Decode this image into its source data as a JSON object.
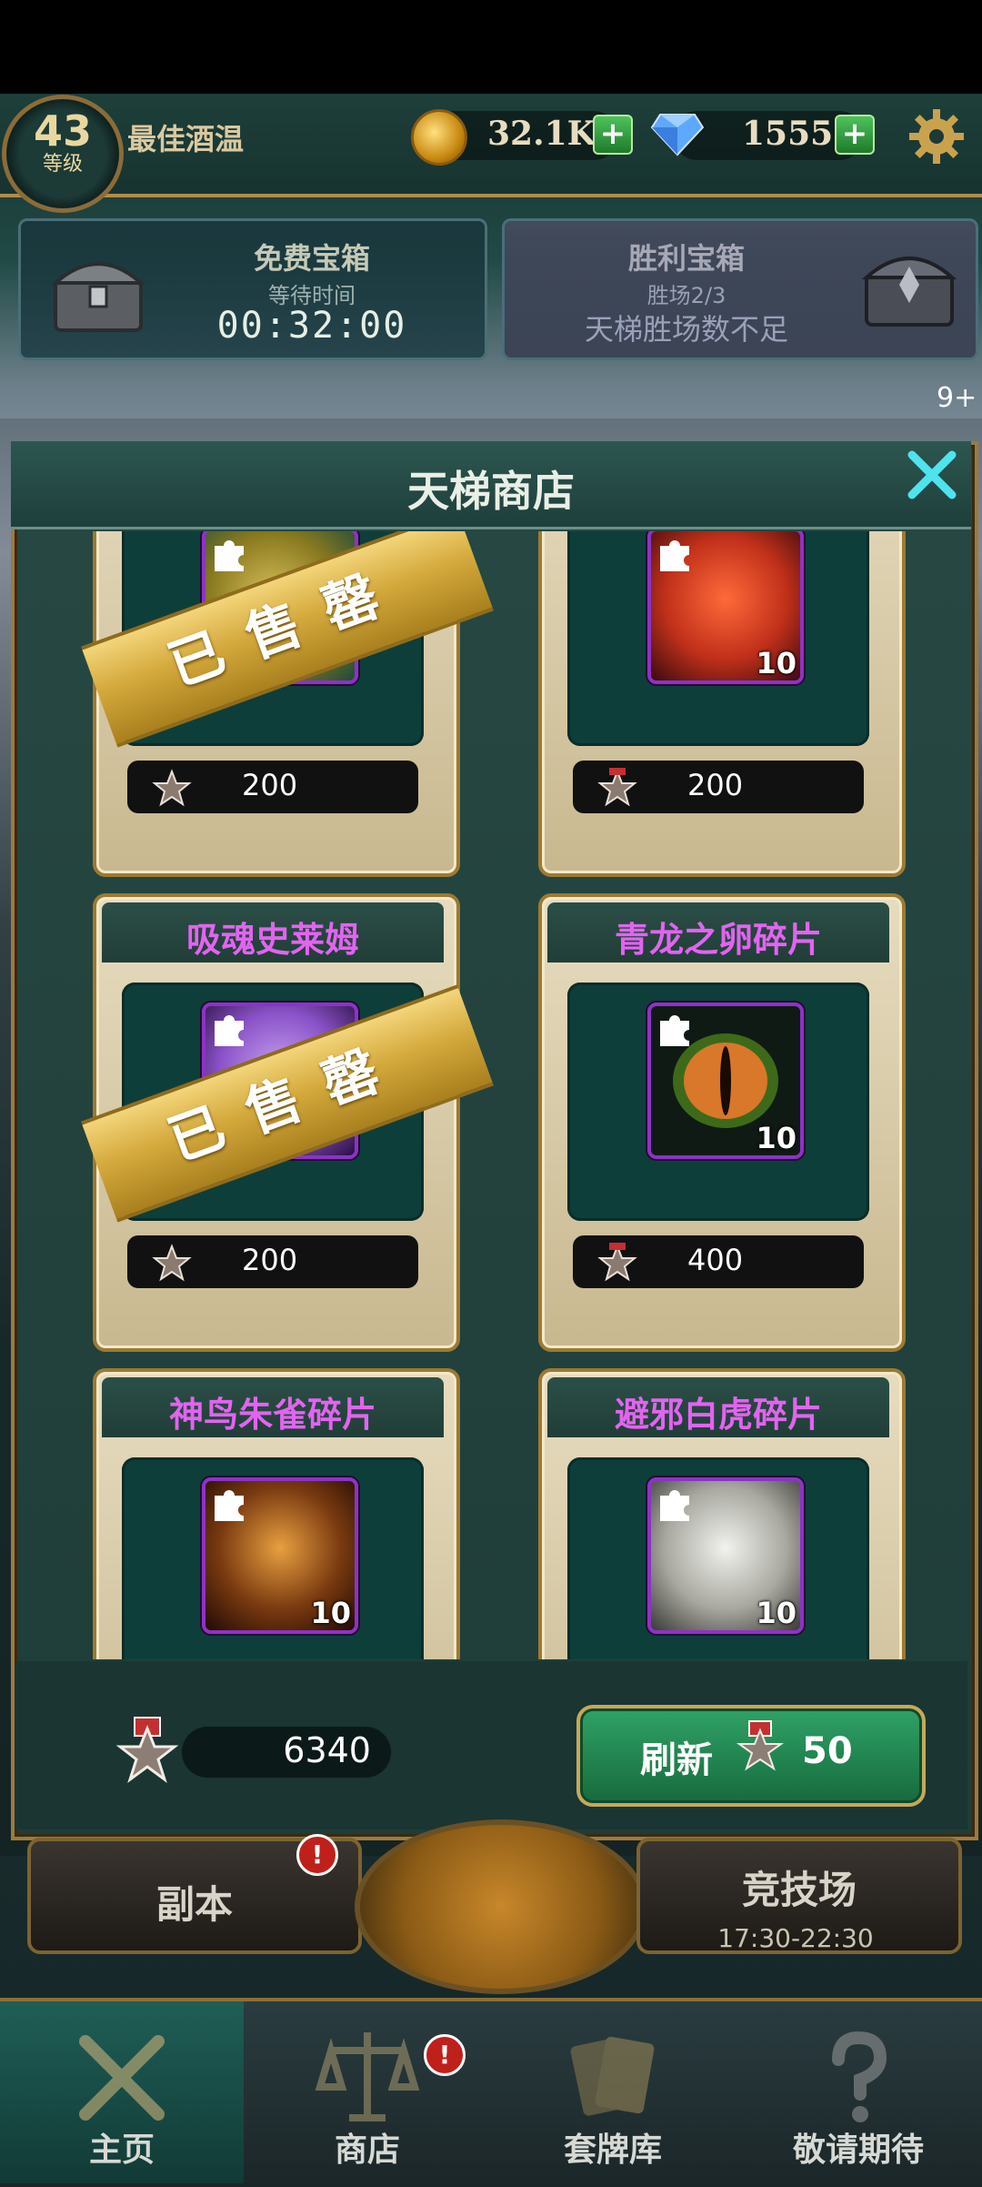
{
  "header": {
    "level": "43",
    "level_label": "等级",
    "player_name": "最佳酒温",
    "gold": "32.1K",
    "gems": "1555",
    "plus": "+"
  },
  "chests": {
    "free": {
      "title": "免费宝箱",
      "subtitle": "等待时间",
      "timer": "00:32:00"
    },
    "victory": {
      "title": "胜利宝箱",
      "subtitle": "胜场2/3",
      "message": "天梯胜场数不足"
    }
  },
  "event_badge": "9+",
  "shop": {
    "title": "天梯商店",
    "sold_out_label": "已售罄",
    "items": [
      {
        "name": "",
        "price": "200",
        "count": "",
        "sold_out": true
      },
      {
        "name": "",
        "price": "200",
        "count": "10",
        "sold_out": false
      },
      {
        "name": "吸魂史莱姆",
        "price": "200",
        "count": "",
        "sold_out": true
      },
      {
        "name": "青龙之卵碎片",
        "price": "400",
        "count": "10",
        "sold_out": false
      },
      {
        "name": "神鸟朱雀碎片",
        "price": "",
        "count": "10",
        "sold_out": false
      },
      {
        "name": "避邪白虎碎片",
        "price": "",
        "count": "10",
        "sold_out": false
      }
    ],
    "balance": "6340",
    "refresh_label": "刷新",
    "refresh_cost": "50"
  },
  "modes": {
    "dungeon": "副本",
    "arena": "竞技场",
    "arena_time": "17:30-22:30",
    "alert": "!"
  },
  "nav": {
    "home": "主页",
    "shop": "商店",
    "decks": "套牌库",
    "coming_soon": "敬请期待"
  },
  "colors": {
    "item_name": "#e264f0",
    "frame_gold": "#9d7a3e",
    "refresh_green": "#2fa267"
  }
}
